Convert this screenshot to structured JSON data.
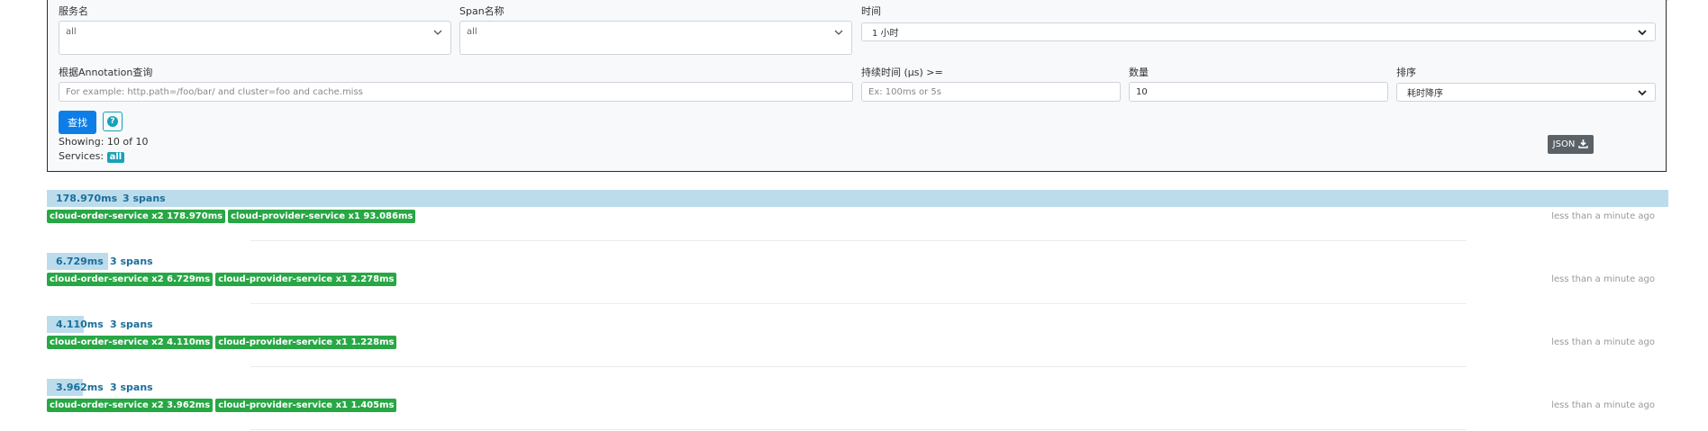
{
  "form": {
    "service_label": "服务名",
    "service_value": "all",
    "span_label": "Span名称",
    "span_value": "all",
    "time_label": "时间",
    "time_value": "1 小时",
    "annotation_label": "根据Annotation查询",
    "annotation_placeholder": "For example: http.path=/foo/bar/ and cluster=foo and cache.miss",
    "duration_label": "持续时间 (μs) >=",
    "duration_placeholder": "Ex: 100ms or 5s",
    "count_label": "数量",
    "count_value": "10",
    "sort_label": "排序",
    "sort_value": "耗时降序",
    "search_button": "查找",
    "help_icon": "question-icon",
    "showing": "Showing: 10 of 10",
    "services_label": "Services:",
    "services_badge": "all",
    "json_button": "JSON",
    "download_icon": "download-icon"
  },
  "traces": [
    {
      "duration": "178.970ms",
      "spans": "3 spans",
      "duration_fraction": 1.0,
      "tags": [
        "cloud-order-service x2 178.970ms",
        "cloud-provider-service x1 93.086ms"
      ],
      "ago": "less than a minute ago"
    },
    {
      "duration": "6.729ms",
      "spans": "3 spans",
      "duration_fraction": 0.0376,
      "tags": [
        "cloud-order-service x2 6.729ms",
        "cloud-provider-service x1 2.278ms"
      ],
      "ago": "less than a minute ago"
    },
    {
      "duration": "4.110ms",
      "spans": "3 spans",
      "duration_fraction": 0.023,
      "tags": [
        "cloud-order-service x2 4.110ms",
        "cloud-provider-service x1 1.228ms"
      ],
      "ago": "less than a minute ago"
    },
    {
      "duration": "3.962ms",
      "spans": "3 spans",
      "duration_fraction": 0.0221,
      "tags": [
        "cloud-order-service x2 3.962ms",
        "cloud-provider-service x1 1.405ms"
      ],
      "ago": "less than a minute ago"
    }
  ]
}
